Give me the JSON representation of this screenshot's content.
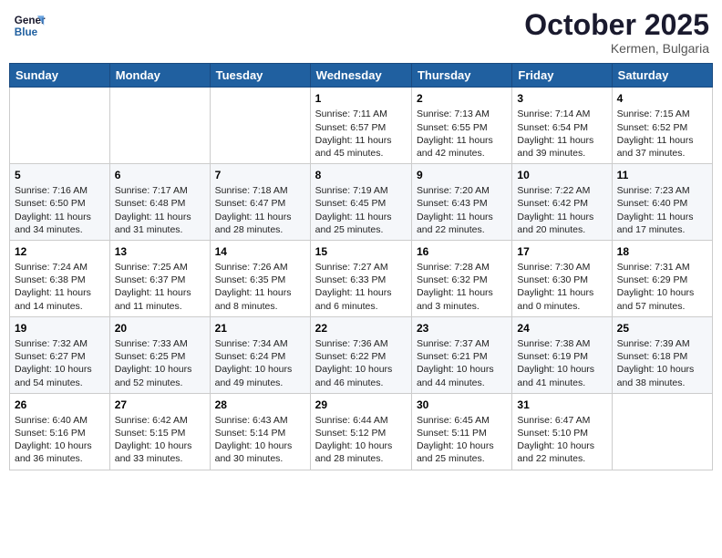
{
  "header": {
    "logo_line1": "General",
    "logo_line2": "Blue",
    "month_title": "October 2025",
    "location": "Kermen, Bulgaria"
  },
  "weekdays": [
    "Sunday",
    "Monday",
    "Tuesday",
    "Wednesday",
    "Thursday",
    "Friday",
    "Saturday"
  ],
  "weeks": [
    [
      {
        "day": "",
        "content": ""
      },
      {
        "day": "",
        "content": ""
      },
      {
        "day": "",
        "content": ""
      },
      {
        "day": "1",
        "content": "Sunrise: 7:11 AM\nSunset: 6:57 PM\nDaylight: 11 hours\nand 45 minutes."
      },
      {
        "day": "2",
        "content": "Sunrise: 7:13 AM\nSunset: 6:55 PM\nDaylight: 11 hours\nand 42 minutes."
      },
      {
        "day": "3",
        "content": "Sunrise: 7:14 AM\nSunset: 6:54 PM\nDaylight: 11 hours\nand 39 minutes."
      },
      {
        "day": "4",
        "content": "Sunrise: 7:15 AM\nSunset: 6:52 PM\nDaylight: 11 hours\nand 37 minutes."
      }
    ],
    [
      {
        "day": "5",
        "content": "Sunrise: 7:16 AM\nSunset: 6:50 PM\nDaylight: 11 hours\nand 34 minutes."
      },
      {
        "day": "6",
        "content": "Sunrise: 7:17 AM\nSunset: 6:48 PM\nDaylight: 11 hours\nand 31 minutes."
      },
      {
        "day": "7",
        "content": "Sunrise: 7:18 AM\nSunset: 6:47 PM\nDaylight: 11 hours\nand 28 minutes."
      },
      {
        "day": "8",
        "content": "Sunrise: 7:19 AM\nSunset: 6:45 PM\nDaylight: 11 hours\nand 25 minutes."
      },
      {
        "day": "9",
        "content": "Sunrise: 7:20 AM\nSunset: 6:43 PM\nDaylight: 11 hours\nand 22 minutes."
      },
      {
        "day": "10",
        "content": "Sunrise: 7:22 AM\nSunset: 6:42 PM\nDaylight: 11 hours\nand 20 minutes."
      },
      {
        "day": "11",
        "content": "Sunrise: 7:23 AM\nSunset: 6:40 PM\nDaylight: 11 hours\nand 17 minutes."
      }
    ],
    [
      {
        "day": "12",
        "content": "Sunrise: 7:24 AM\nSunset: 6:38 PM\nDaylight: 11 hours\nand 14 minutes."
      },
      {
        "day": "13",
        "content": "Sunrise: 7:25 AM\nSunset: 6:37 PM\nDaylight: 11 hours\nand 11 minutes."
      },
      {
        "day": "14",
        "content": "Sunrise: 7:26 AM\nSunset: 6:35 PM\nDaylight: 11 hours\nand 8 minutes."
      },
      {
        "day": "15",
        "content": "Sunrise: 7:27 AM\nSunset: 6:33 PM\nDaylight: 11 hours\nand 6 minutes."
      },
      {
        "day": "16",
        "content": "Sunrise: 7:28 AM\nSunset: 6:32 PM\nDaylight: 11 hours\nand 3 minutes."
      },
      {
        "day": "17",
        "content": "Sunrise: 7:30 AM\nSunset: 6:30 PM\nDaylight: 11 hours\nand 0 minutes."
      },
      {
        "day": "18",
        "content": "Sunrise: 7:31 AM\nSunset: 6:29 PM\nDaylight: 10 hours\nand 57 minutes."
      }
    ],
    [
      {
        "day": "19",
        "content": "Sunrise: 7:32 AM\nSunset: 6:27 PM\nDaylight: 10 hours\nand 54 minutes."
      },
      {
        "day": "20",
        "content": "Sunrise: 7:33 AM\nSunset: 6:25 PM\nDaylight: 10 hours\nand 52 minutes."
      },
      {
        "day": "21",
        "content": "Sunrise: 7:34 AM\nSunset: 6:24 PM\nDaylight: 10 hours\nand 49 minutes."
      },
      {
        "day": "22",
        "content": "Sunrise: 7:36 AM\nSunset: 6:22 PM\nDaylight: 10 hours\nand 46 minutes."
      },
      {
        "day": "23",
        "content": "Sunrise: 7:37 AM\nSunset: 6:21 PM\nDaylight: 10 hours\nand 44 minutes."
      },
      {
        "day": "24",
        "content": "Sunrise: 7:38 AM\nSunset: 6:19 PM\nDaylight: 10 hours\nand 41 minutes."
      },
      {
        "day": "25",
        "content": "Sunrise: 7:39 AM\nSunset: 6:18 PM\nDaylight: 10 hours\nand 38 minutes."
      }
    ],
    [
      {
        "day": "26",
        "content": "Sunrise: 6:40 AM\nSunset: 5:16 PM\nDaylight: 10 hours\nand 36 minutes."
      },
      {
        "day": "27",
        "content": "Sunrise: 6:42 AM\nSunset: 5:15 PM\nDaylight: 10 hours\nand 33 minutes."
      },
      {
        "day": "28",
        "content": "Sunrise: 6:43 AM\nSunset: 5:14 PM\nDaylight: 10 hours\nand 30 minutes."
      },
      {
        "day": "29",
        "content": "Sunrise: 6:44 AM\nSunset: 5:12 PM\nDaylight: 10 hours\nand 28 minutes."
      },
      {
        "day": "30",
        "content": "Sunrise: 6:45 AM\nSunset: 5:11 PM\nDaylight: 10 hours\nand 25 minutes."
      },
      {
        "day": "31",
        "content": "Sunrise: 6:47 AM\nSunset: 5:10 PM\nDaylight: 10 hours\nand 22 minutes."
      },
      {
        "day": "",
        "content": ""
      }
    ]
  ]
}
